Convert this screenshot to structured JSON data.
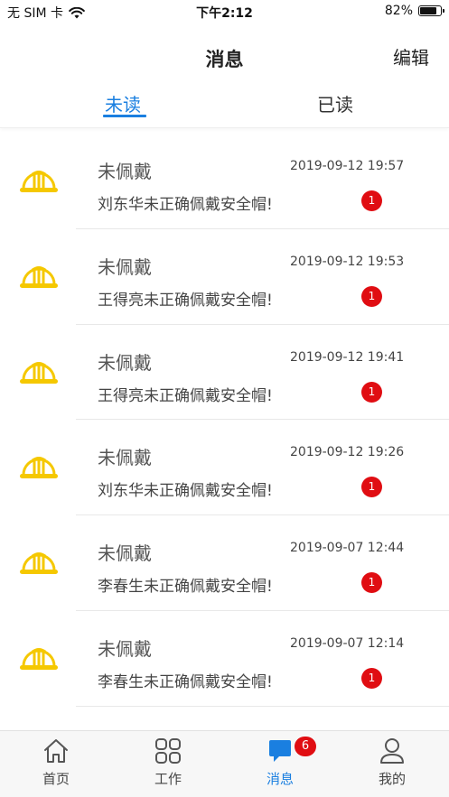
{
  "status_bar": {
    "carrier": "无 SIM 卡",
    "time": "下午2:12",
    "battery_percent": "82%",
    "battery_level": 0.82
  },
  "nav": {
    "title": "消息",
    "edit_label": "编辑"
  },
  "tabs": {
    "unread": "未读",
    "read": "已读",
    "active": "unread"
  },
  "messages": [
    {
      "title": "未佩戴",
      "time": "2019-09-12 19:57",
      "desc": "刘东华未正确佩戴安全帽!",
      "badge": "1"
    },
    {
      "title": "未佩戴",
      "time": "2019-09-12 19:53",
      "desc": "王得亮未正确佩戴安全帽!",
      "badge": "1"
    },
    {
      "title": "未佩戴",
      "time": "2019-09-12 19:41",
      "desc": "王得亮未正确佩戴安全帽!",
      "badge": "1"
    },
    {
      "title": "未佩戴",
      "time": "2019-09-12 19:26",
      "desc": "刘东华未正确佩戴安全帽!",
      "badge": "1"
    },
    {
      "title": "未佩戴",
      "time": "2019-09-07 12:44",
      "desc": "李春生未正确佩戴安全帽!",
      "badge": "1"
    },
    {
      "title": "未佩戴",
      "time": "2019-09-07 12:14",
      "desc": "李春生未正确佩戴安全帽!",
      "badge": "1"
    }
  ],
  "tab_bar": {
    "items": [
      {
        "label": "首页",
        "icon": "home-icon"
      },
      {
        "label": "工作",
        "icon": "grid-icon"
      },
      {
        "label": "消息",
        "icon": "chat-icon"
      },
      {
        "label": "我的",
        "icon": "person-icon"
      }
    ],
    "active_index": 2,
    "message_badge": "6"
  },
  "colors": {
    "accent": "#1a7fe0",
    "badge": "#e00d12",
    "helmet": "#f5c800"
  }
}
